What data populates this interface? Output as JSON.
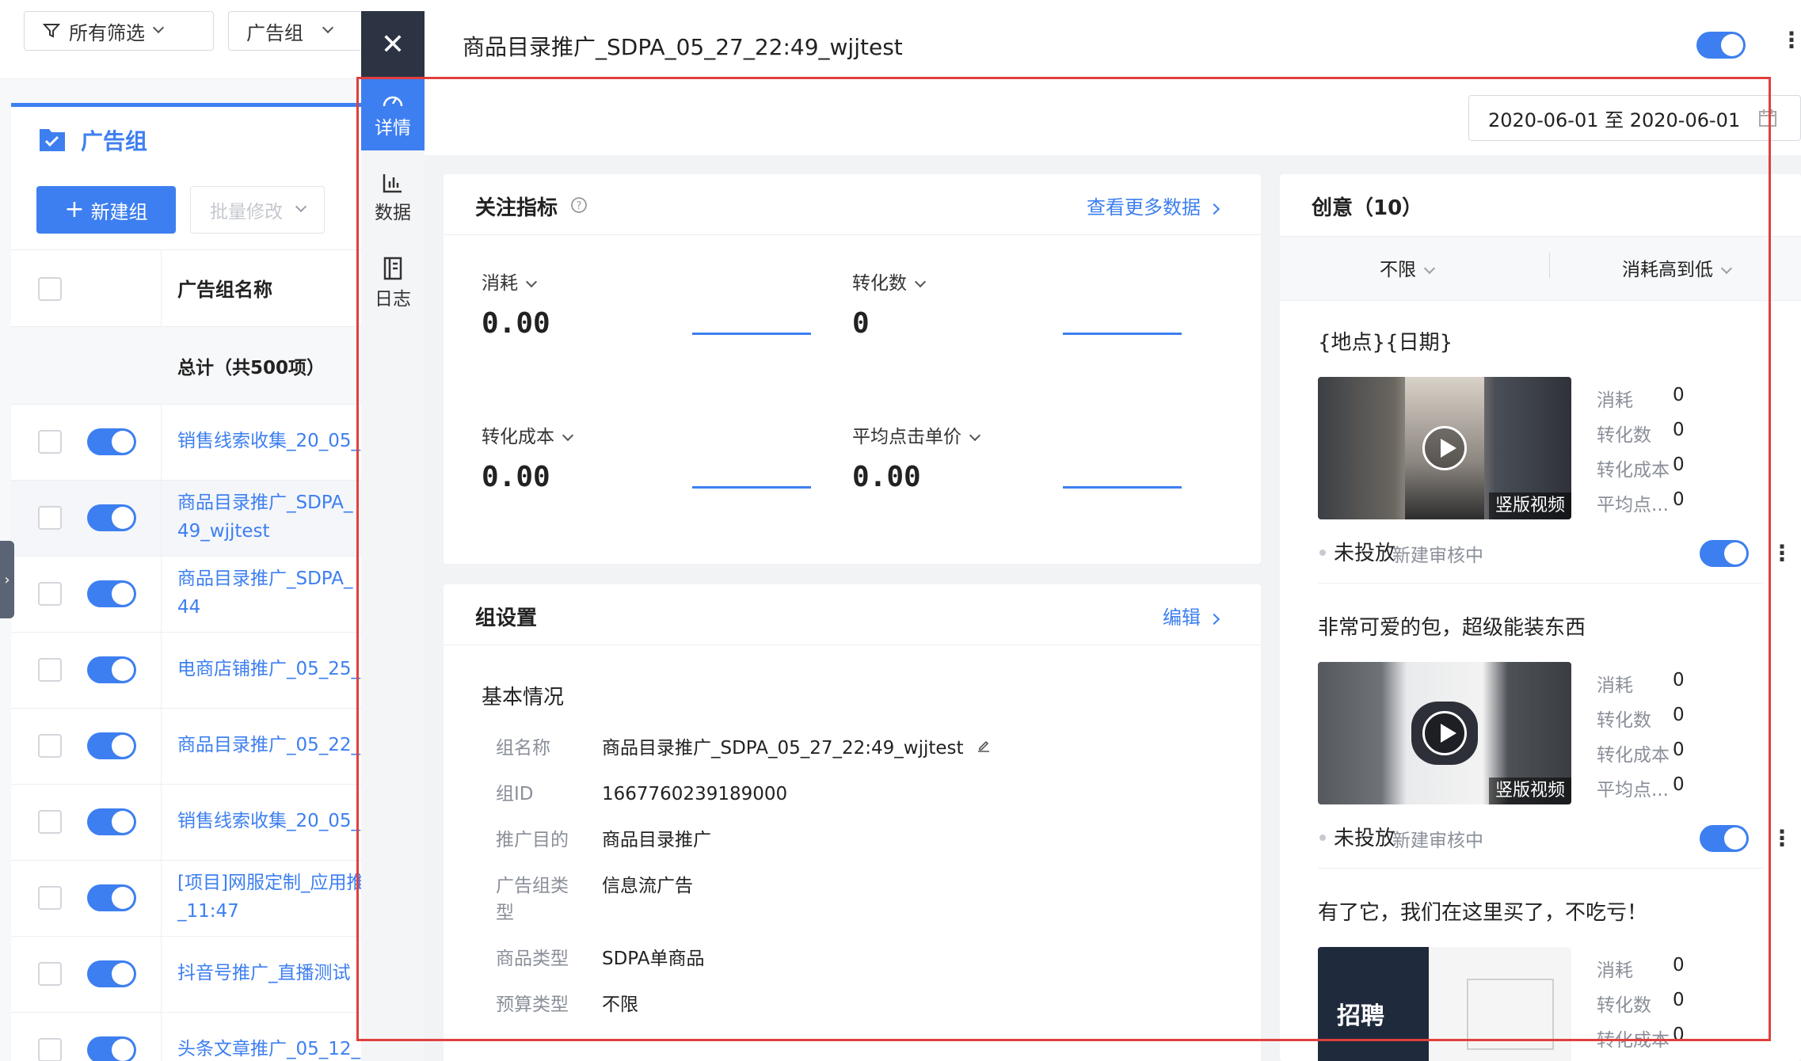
{
  "filters": {
    "all_filters": "所有筛选",
    "ad_group": "广告组"
  },
  "left_panel": {
    "title": "广告组",
    "new_group_button": "新建组",
    "batch_edit_button": "批量修改",
    "column_name": "广告组名称",
    "total_label": "总计（共500项）",
    "rows": [
      {
        "line1": "销售线索收集_20_05_",
        "line2": ""
      },
      {
        "line1": "商品目录推广_SDPA_",
        "line2": "49_wjjtest"
      },
      {
        "line1": "商品目录推广_SDPA_",
        "line2": "44"
      },
      {
        "line1": "电商店铺推广_05_25_",
        "line2": ""
      },
      {
        "line1": "商品目录推广_05_22_",
        "line2": ""
      },
      {
        "line1": "销售线索收集_20_05_",
        "line2": ""
      },
      {
        "line1": "[项目]网服定制_应用推",
        "line2": "_11:47"
      },
      {
        "line1": "抖音号推广_直播测试",
        "line2": ""
      },
      {
        "line1": "头条文章推广_05_12_",
        "line2": ""
      }
    ]
  },
  "drawer": {
    "title": "商品目录推广_SDPA_05_27_22:49_wjjtest",
    "close_icon": "close-icon",
    "rail": [
      {
        "label": "详情",
        "icon": "dashboard-icon"
      },
      {
        "label": "数据",
        "icon": "bar-chart-icon"
      },
      {
        "label": "日志",
        "icon": "log-icon"
      }
    ],
    "date_range": "2020-06-01 至 2020-06-01"
  },
  "metrics_card": {
    "title": "关注指标",
    "more_link": "查看更多数据",
    "metrics": [
      {
        "label": "消耗",
        "value": "0.00"
      },
      {
        "label": "转化数",
        "value": "0"
      },
      {
        "label": "转化成本",
        "value": "0.00"
      },
      {
        "label": "平均点击单价",
        "value": "0.00"
      }
    ]
  },
  "settings_card": {
    "title": "组设置",
    "edit_link": "编辑",
    "section": "基本情况",
    "fields": [
      {
        "key": "组名称",
        "value": "商品目录推广_SDPA_05_27_22:49_wjjtest"
      },
      {
        "key": "组ID",
        "value": "1667760239189000"
      },
      {
        "key": "推广目的",
        "value": "商品目录推广"
      },
      {
        "key": "广告组类型",
        "value": "信息流广告"
      },
      {
        "key": "商品类型",
        "value": "SDPA单商品"
      },
      {
        "key": "预算类型",
        "value": "不限"
      }
    ]
  },
  "creative_card": {
    "title": "创意（10）",
    "filter1": "不限",
    "filter2": "消耗高到低",
    "items": [
      {
        "title": "{地点}{日期}",
        "tag": "竖版视频",
        "stats": [
          {
            "k": "消耗",
            "v": "0"
          },
          {
            "k": "转化数",
            "v": "0"
          },
          {
            "k": "转化成本",
            "v": "0"
          },
          {
            "k": "平均点...",
            "v": "0"
          }
        ],
        "status": "未投放",
        "review": "新建审核中"
      },
      {
        "title": "非常可爱的包，超级能装东西",
        "tag": "竖版视频",
        "stats": [
          {
            "k": "消耗",
            "v": "0"
          },
          {
            "k": "转化数",
            "v": "0"
          },
          {
            "k": "转化成本",
            "v": "0"
          },
          {
            "k": "平均点...",
            "v": "0"
          }
        ],
        "status": "未投放",
        "review": "新建审核中"
      },
      {
        "title": "有了它，我们在这里买了，不吃亏！",
        "tag": "招聘",
        "stats": [
          {
            "k": "消耗",
            "v": "0"
          },
          {
            "k": "转化数",
            "v": "0"
          },
          {
            "k": "转化成本",
            "v": "0"
          }
        ],
        "status": "",
        "review": ""
      }
    ]
  },
  "colors": {
    "accent": "#3d7ff0",
    "highlight_box": "#e0403e",
    "dark_nav": "#2c3444"
  }
}
